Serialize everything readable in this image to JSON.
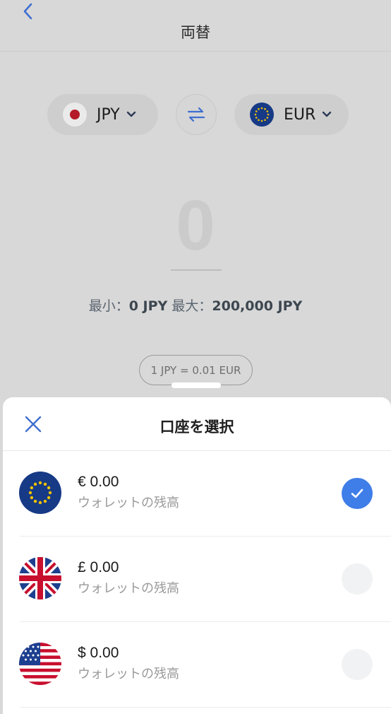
{
  "header": {
    "title": "両替",
    "back_icon": "chevron-left-icon"
  },
  "converter": {
    "from": {
      "code": "JPY",
      "flag": "japan-flag-icon"
    },
    "to": {
      "code": "EUR",
      "flag": "eu-flag-icon"
    },
    "swap_icon": "swap-arrows-icon",
    "amount": "0",
    "limits": {
      "min_label": "最小：",
      "min_value": "0 JPY",
      "max_label": "最大：",
      "max_value": "200,000 JPY"
    },
    "rate": "1 JPY = 0.01 EUR"
  },
  "sheet": {
    "title": "口座を選択",
    "close_icon": "close-icon",
    "accounts": [
      {
        "balance": "€ 0.00",
        "subtitle": "ウォレットの残高",
        "flag": "eu-flag-icon",
        "selected": true
      },
      {
        "balance": "£ 0.00",
        "subtitle": "ウォレットの残高",
        "flag": "uk-flag-icon",
        "selected": false
      },
      {
        "balance": "$ 0.00",
        "subtitle": "ウォレットの残高",
        "flag": "us-flag-icon",
        "selected": false
      }
    ]
  },
  "colors": {
    "accent": "#3f7de8",
    "eu_blue": "#173a86",
    "japan_red": "#b41a27"
  }
}
